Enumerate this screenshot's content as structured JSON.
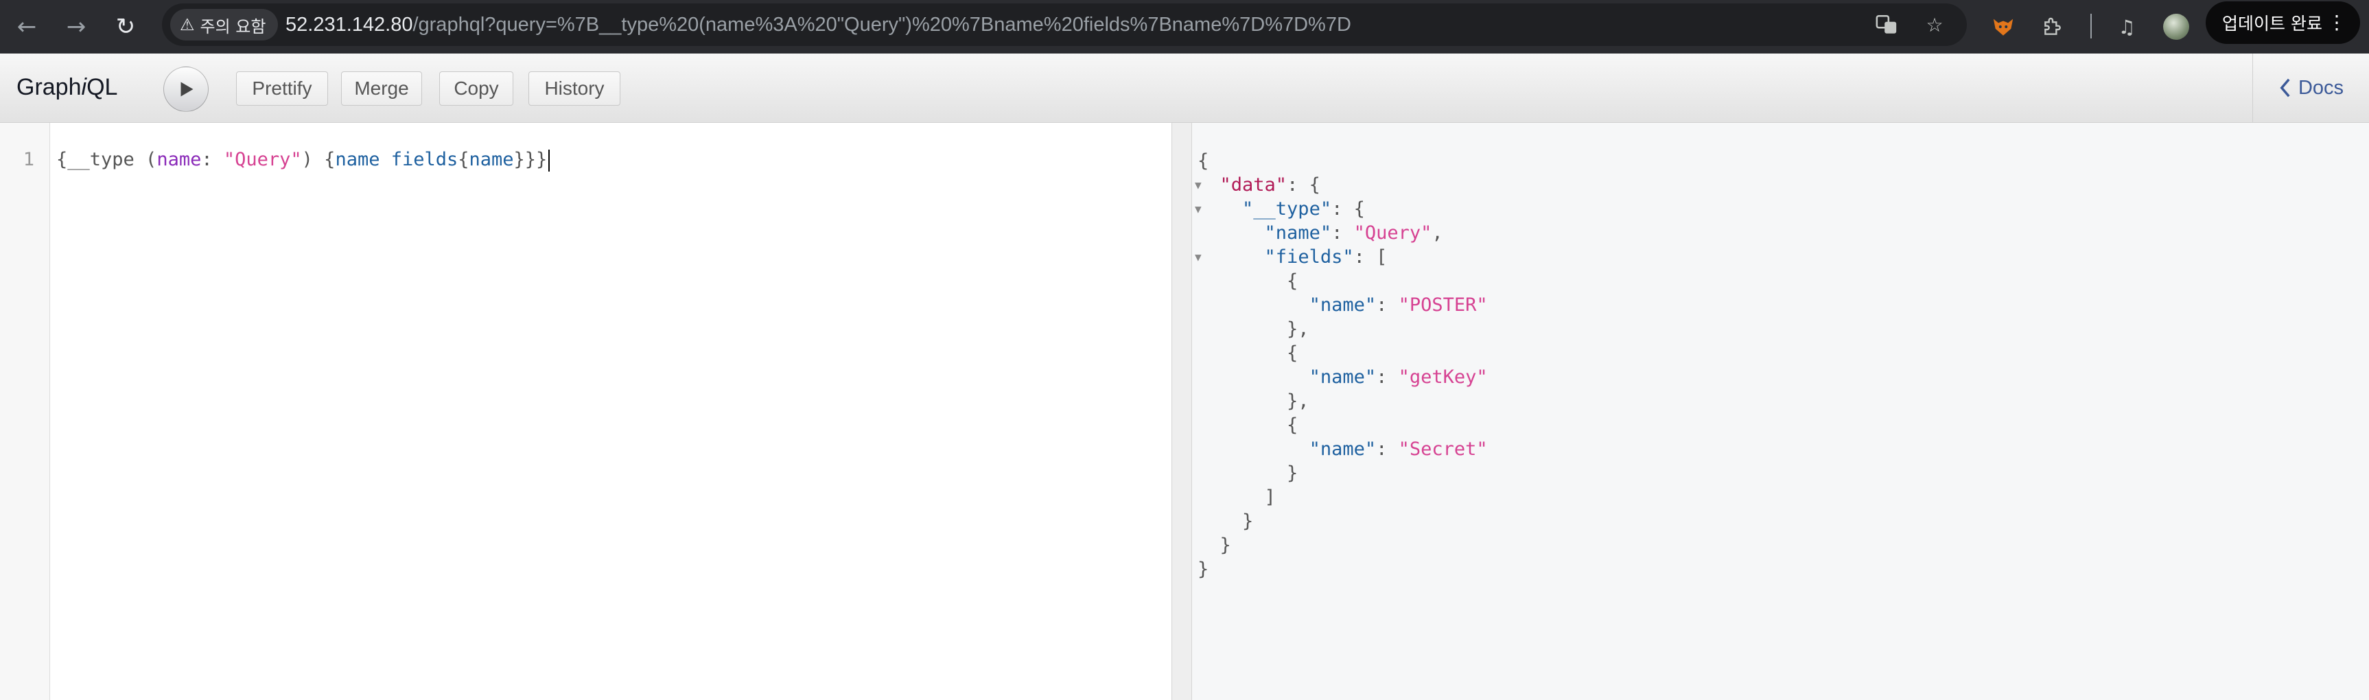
{
  "browser": {
    "back_icon": "arrow-left-icon",
    "forward_icon": "arrow-right-icon",
    "reload_icon": "reload-icon",
    "security_label": "주의 요함",
    "url_host": "52.231.142.80",
    "url_path": "/graphql?query=%7B__type%20(name%3A%20\"Query\")%20%7Bname%20fields%7Bname%7D%7D%7D",
    "update_label": "업데이트 완료",
    "menu_label": "⋮"
  },
  "toolbar": {
    "title_prefix": "Graph",
    "title_italic": "i",
    "title_suffix": "QL",
    "prettify_label": "Prettify",
    "merge_label": "Merge",
    "copy_label": "Copy",
    "history_label": "History",
    "docs_label": "Docs"
  },
  "editor": {
    "line_number": "1",
    "tokens": {
      "t1": "{__type (",
      "t2": "name",
      "t3": ": ",
      "t4": "\"Query\"",
      "t5": ") {",
      "t6": "name fields",
      "t7": "{",
      "t8": "name",
      "t9": "}}}"
    }
  },
  "result": {
    "data_key": "\"data\"",
    "type_key": "\"__type\"",
    "name_key": "\"name\"",
    "name_value": "\"Query\"",
    "fields_key": "\"fields\"",
    "fields": [
      {
        "key": "\"name\"",
        "value": "\"POSTER\""
      },
      {
        "key": "\"name\"",
        "value": "\"getKey\""
      },
      {
        "key": "\"name\"",
        "value": "\"Secret\""
      }
    ]
  },
  "colors": {
    "accent_link": "#3b5998",
    "string": "#d64292",
    "key": "#b11a56"
  }
}
